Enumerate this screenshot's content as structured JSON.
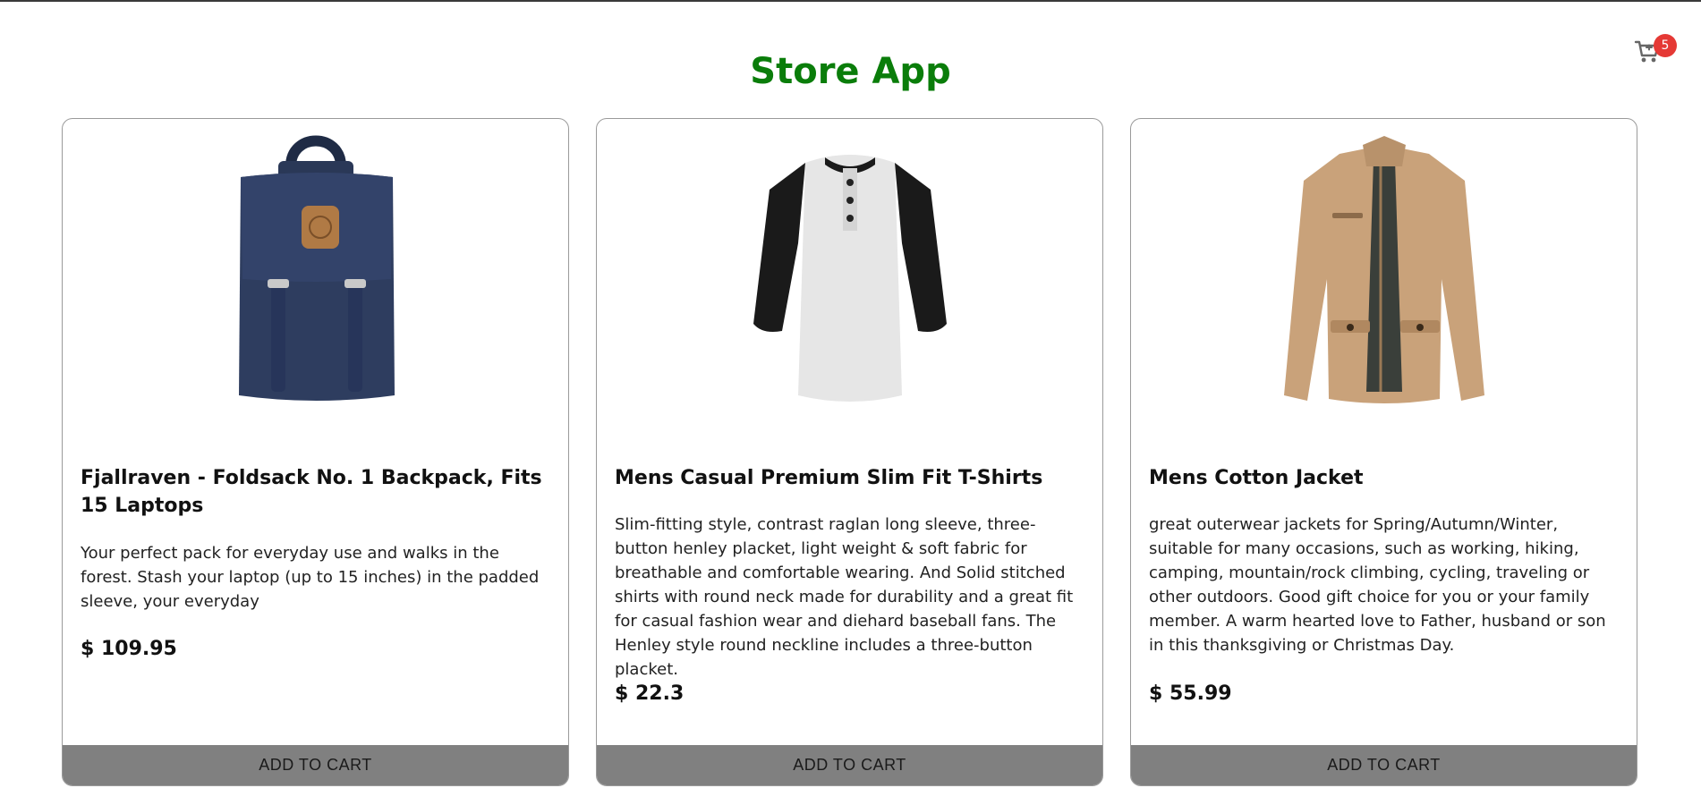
{
  "header": {
    "title": "Store App",
    "cart_count": "5",
    "cart_icon": "shopping-cart-icon"
  },
  "colors": {
    "title": "#0a7d0a",
    "badge": "#e53935",
    "button": "#808080"
  },
  "products": [
    {
      "image": "navy backpack",
      "name": "Fjallraven - Foldsack No. 1 Backpack, Fits 15 Laptops",
      "description": "Your perfect pack for everyday use and walks in the forest. Stash your laptop (up to 15 inches) in the padded sleeve, your everyday",
      "price": "$ 109.95",
      "button": "ADD TO CART"
    },
    {
      "image": "raglan henley t-shirt",
      "name": "Mens Casual Premium Slim Fit T-Shirts",
      "description": "Slim-fitting style, contrast raglan long sleeve, three-button henley placket, light weight & soft fabric for breathable and comfortable wearing. And Solid stitched shirts with round neck made for durability and a great fit for casual fashion wear and diehard baseball fans. The Henley style round neckline includes a three-button placket.",
      "price": "$ 22.3",
      "button": "ADD TO CART"
    },
    {
      "image": "khaki cotton jacket",
      "name": "Mens Cotton Jacket",
      "description": "great outerwear jackets for Spring/Autumn/Winter, suitable for many occasions, such as working, hiking, camping, mountain/rock climbing, cycling, traveling or other outdoors. Good gift choice for you or your family member. A warm hearted love to Father, husband or son in this thanksgiving or Christmas Day.",
      "price": "$ 55.99",
      "button": "ADD TO CART"
    }
  ]
}
